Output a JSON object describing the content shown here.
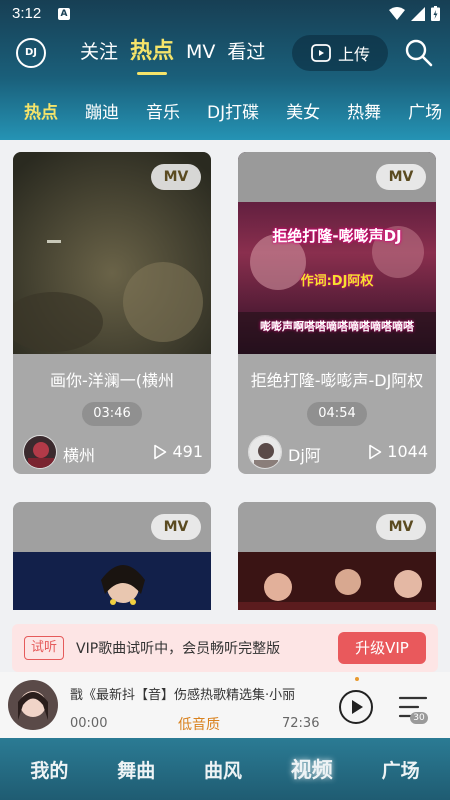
{
  "status": {
    "time": "3:12",
    "notif_letter": "A"
  },
  "header": {
    "logo_text": "DJ",
    "tabs": [
      {
        "label": "关注",
        "active": false
      },
      {
        "label": "热点",
        "active": true
      },
      {
        "label": "MV",
        "active": false
      },
      {
        "label": "看过",
        "active": false
      }
    ],
    "upload_label": "上传",
    "categories": [
      {
        "label": "热点",
        "active": true
      },
      {
        "label": "蹦迪",
        "active": false
      },
      {
        "label": "音乐",
        "active": false
      },
      {
        "label": "DJ打碟",
        "active": false
      },
      {
        "label": "美女",
        "active": false
      },
      {
        "label": "热舞",
        "active": false
      },
      {
        "label": "广场",
        "active": false
      }
    ]
  },
  "cards": [
    {
      "badge": "MV",
      "title": "画你-洋澜一(横州",
      "duration": "03:46",
      "author": "横州",
      "plays": "491",
      "overlay": []
    },
    {
      "badge": "MV",
      "title": "拒绝打隆-嘭嘭声-DJ阿权",
      "duration": "04:54",
      "author": "Dj阿",
      "plays": "1044",
      "overlay": [
        "拒绝打隆-嘭嘭声DJ",
        "作词:DJ阿权",
        "嘭嘭声啊嗒嗒嘀嗒嘀嗒嘀嗒嘀嗒"
      ]
    },
    {
      "badge": "MV"
    },
    {
      "badge": "MV"
    }
  ],
  "vip_bar": {
    "tag": "试听",
    "message": "VIP歌曲试听中，会员畅听完整版",
    "button": "升级VIP"
  },
  "player": {
    "song": "戬《最新抖【音】伤感热歌精选集·小丽",
    "current_time": "00:00",
    "quality": "低音质",
    "total_time": "72:36",
    "playlist_count": "30"
  },
  "bottom_nav": [
    {
      "label": "我的",
      "active": false
    },
    {
      "label": "舞曲",
      "active": false
    },
    {
      "label": "曲风",
      "active": false
    },
    {
      "label": "视频",
      "active": true
    },
    {
      "label": "广场",
      "active": false
    }
  ],
  "colors": {
    "accent": "#f5e46a",
    "vip": "#e9595c",
    "quality": "#d9821f"
  }
}
